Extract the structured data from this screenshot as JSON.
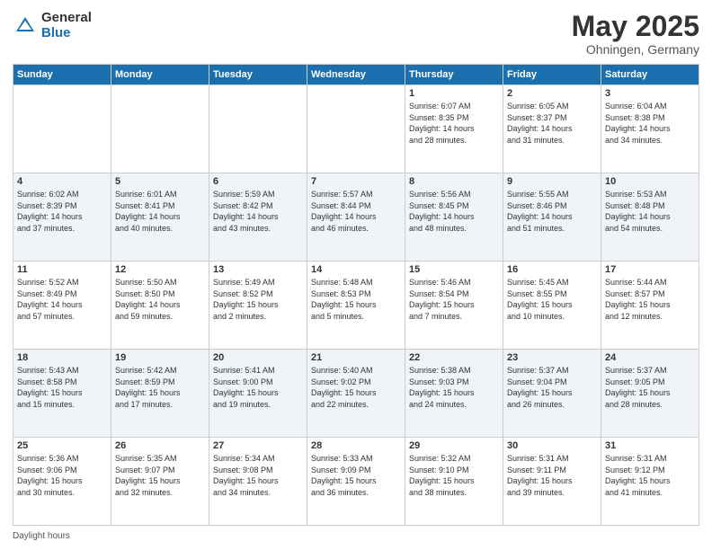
{
  "logo": {
    "general": "General",
    "blue": "Blue"
  },
  "title": "May 2025",
  "subtitle": "Ohningen, Germany",
  "days_header": [
    "Sunday",
    "Monday",
    "Tuesday",
    "Wednesday",
    "Thursday",
    "Friday",
    "Saturday"
  ],
  "footer": "Daylight hours",
  "weeks": [
    [
      {
        "num": "",
        "info": ""
      },
      {
        "num": "",
        "info": ""
      },
      {
        "num": "",
        "info": ""
      },
      {
        "num": "",
        "info": ""
      },
      {
        "num": "1",
        "info": "Sunrise: 6:07 AM\nSunset: 8:35 PM\nDaylight: 14 hours\nand 28 minutes."
      },
      {
        "num": "2",
        "info": "Sunrise: 6:05 AM\nSunset: 8:37 PM\nDaylight: 14 hours\nand 31 minutes."
      },
      {
        "num": "3",
        "info": "Sunrise: 6:04 AM\nSunset: 8:38 PM\nDaylight: 14 hours\nand 34 minutes."
      }
    ],
    [
      {
        "num": "4",
        "info": "Sunrise: 6:02 AM\nSunset: 8:39 PM\nDaylight: 14 hours\nand 37 minutes."
      },
      {
        "num": "5",
        "info": "Sunrise: 6:01 AM\nSunset: 8:41 PM\nDaylight: 14 hours\nand 40 minutes."
      },
      {
        "num": "6",
        "info": "Sunrise: 5:59 AM\nSunset: 8:42 PM\nDaylight: 14 hours\nand 43 minutes."
      },
      {
        "num": "7",
        "info": "Sunrise: 5:57 AM\nSunset: 8:44 PM\nDaylight: 14 hours\nand 46 minutes."
      },
      {
        "num": "8",
        "info": "Sunrise: 5:56 AM\nSunset: 8:45 PM\nDaylight: 14 hours\nand 48 minutes."
      },
      {
        "num": "9",
        "info": "Sunrise: 5:55 AM\nSunset: 8:46 PM\nDaylight: 14 hours\nand 51 minutes."
      },
      {
        "num": "10",
        "info": "Sunrise: 5:53 AM\nSunset: 8:48 PM\nDaylight: 14 hours\nand 54 minutes."
      }
    ],
    [
      {
        "num": "11",
        "info": "Sunrise: 5:52 AM\nSunset: 8:49 PM\nDaylight: 14 hours\nand 57 minutes."
      },
      {
        "num": "12",
        "info": "Sunrise: 5:50 AM\nSunset: 8:50 PM\nDaylight: 14 hours\nand 59 minutes."
      },
      {
        "num": "13",
        "info": "Sunrise: 5:49 AM\nSunset: 8:52 PM\nDaylight: 15 hours\nand 2 minutes."
      },
      {
        "num": "14",
        "info": "Sunrise: 5:48 AM\nSunset: 8:53 PM\nDaylight: 15 hours\nand 5 minutes."
      },
      {
        "num": "15",
        "info": "Sunrise: 5:46 AM\nSunset: 8:54 PM\nDaylight: 15 hours\nand 7 minutes."
      },
      {
        "num": "16",
        "info": "Sunrise: 5:45 AM\nSunset: 8:55 PM\nDaylight: 15 hours\nand 10 minutes."
      },
      {
        "num": "17",
        "info": "Sunrise: 5:44 AM\nSunset: 8:57 PM\nDaylight: 15 hours\nand 12 minutes."
      }
    ],
    [
      {
        "num": "18",
        "info": "Sunrise: 5:43 AM\nSunset: 8:58 PM\nDaylight: 15 hours\nand 15 minutes."
      },
      {
        "num": "19",
        "info": "Sunrise: 5:42 AM\nSunset: 8:59 PM\nDaylight: 15 hours\nand 17 minutes."
      },
      {
        "num": "20",
        "info": "Sunrise: 5:41 AM\nSunset: 9:00 PM\nDaylight: 15 hours\nand 19 minutes."
      },
      {
        "num": "21",
        "info": "Sunrise: 5:40 AM\nSunset: 9:02 PM\nDaylight: 15 hours\nand 22 minutes."
      },
      {
        "num": "22",
        "info": "Sunrise: 5:38 AM\nSunset: 9:03 PM\nDaylight: 15 hours\nand 24 minutes."
      },
      {
        "num": "23",
        "info": "Sunrise: 5:37 AM\nSunset: 9:04 PM\nDaylight: 15 hours\nand 26 minutes."
      },
      {
        "num": "24",
        "info": "Sunrise: 5:37 AM\nSunset: 9:05 PM\nDaylight: 15 hours\nand 28 minutes."
      }
    ],
    [
      {
        "num": "25",
        "info": "Sunrise: 5:36 AM\nSunset: 9:06 PM\nDaylight: 15 hours\nand 30 minutes."
      },
      {
        "num": "26",
        "info": "Sunrise: 5:35 AM\nSunset: 9:07 PM\nDaylight: 15 hours\nand 32 minutes."
      },
      {
        "num": "27",
        "info": "Sunrise: 5:34 AM\nSunset: 9:08 PM\nDaylight: 15 hours\nand 34 minutes."
      },
      {
        "num": "28",
        "info": "Sunrise: 5:33 AM\nSunset: 9:09 PM\nDaylight: 15 hours\nand 36 minutes."
      },
      {
        "num": "29",
        "info": "Sunrise: 5:32 AM\nSunset: 9:10 PM\nDaylight: 15 hours\nand 38 minutes."
      },
      {
        "num": "30",
        "info": "Sunrise: 5:31 AM\nSunset: 9:11 PM\nDaylight: 15 hours\nand 39 minutes."
      },
      {
        "num": "31",
        "info": "Sunrise: 5:31 AM\nSunset: 9:12 PM\nDaylight: 15 hours\nand 41 minutes."
      }
    ]
  ]
}
